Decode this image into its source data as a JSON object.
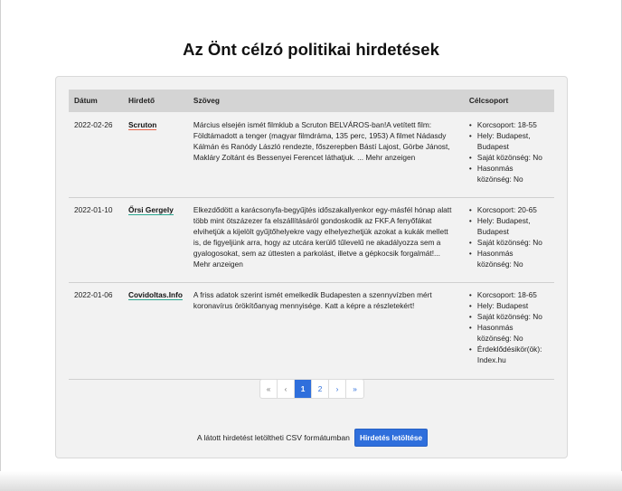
{
  "title": "Az Önt célzó politikai hirdetések",
  "table": {
    "headers": {
      "date": "Dátum",
      "advertiser": "Hirdető",
      "text": "Szöveg",
      "target": "Célcsoport"
    },
    "rows": [
      {
        "date": "2022-02-26",
        "advertiser": "Scruton",
        "underline_color": "#e7644a",
        "text": "Március elsején ismét filmklub a Scruton BELVÁROS-ban!A vetített film: Földtámadott a tenger (magyar filmdráma, 135 perc, 1953) A filmet Nádasdy Kálmán és Ranódy László rendezte, főszerepben Bástí Lajost, Görbe Jánost, Makláry Zoltánt és Bessenyei Ferencet láthatjuk. ... Mehr anzeigen",
        "target": [
          "Korcsoport: 18-55",
          "Hely: Budapest, Budapest",
          "Saját közönség: No",
          "Hasonmás közönség: No"
        ]
      },
      {
        "date": "2022-01-10",
        "advertiser": "Őrsi Gergely",
        "underline_color": "#2aa68f",
        "text": "Elkezdődött a karácsonyfa-begyűjtés időszakallyenkor egy-másfél hónap alatt több mint ötszázezer fa elszállításáról gondoskodik az FKF.A fenyőfákat elvihetjük a kijelölt gyűjtőhelyekre vagy elhelyezhetjük azokat a kukák mellett is, de figyeljünk arra, hogy az utcára kerülő tűlevelű ne akadályozza sem a gyalogosokat, sem az úttesten a parkolást, illetve a gépkocsik forgalmát!... Mehr anzeigen",
        "target": [
          "Korcsoport: 20-65",
          "Hely: Budapest, Budapest",
          "Saját közönség: No",
          "Hasonmás közönség: No"
        ]
      },
      {
        "date": "2022-01-06",
        "advertiser": "Covidoltas.Info",
        "underline_color": "#2aa68f",
        "text": "A friss adatok szerint ismét emelkedik Budapesten a szennyvízben mért koronavírus örökítőanyag mennyisége. Katt a képre a részletekért!",
        "target": [
          "Korcsoport: 18-65",
          "Hely: Budapest",
          "Saját közönség: No",
          "Hasonmás közönség: No",
          "Érdeklődésikör(ök): Index.hu"
        ]
      }
    ]
  },
  "pagination": {
    "first": "«",
    "prev": "‹",
    "pages": [
      "1",
      "2"
    ],
    "active_page": "1",
    "next": "›",
    "last": "»"
  },
  "csv": {
    "label": "A látott hirdetést letöltheti CSV formátumban",
    "button": "Hirdetés letöltése"
  },
  "colors": {
    "accent": "#2f6fdc",
    "panel": "#f2f2f2",
    "header": "#d4d4d4"
  }
}
